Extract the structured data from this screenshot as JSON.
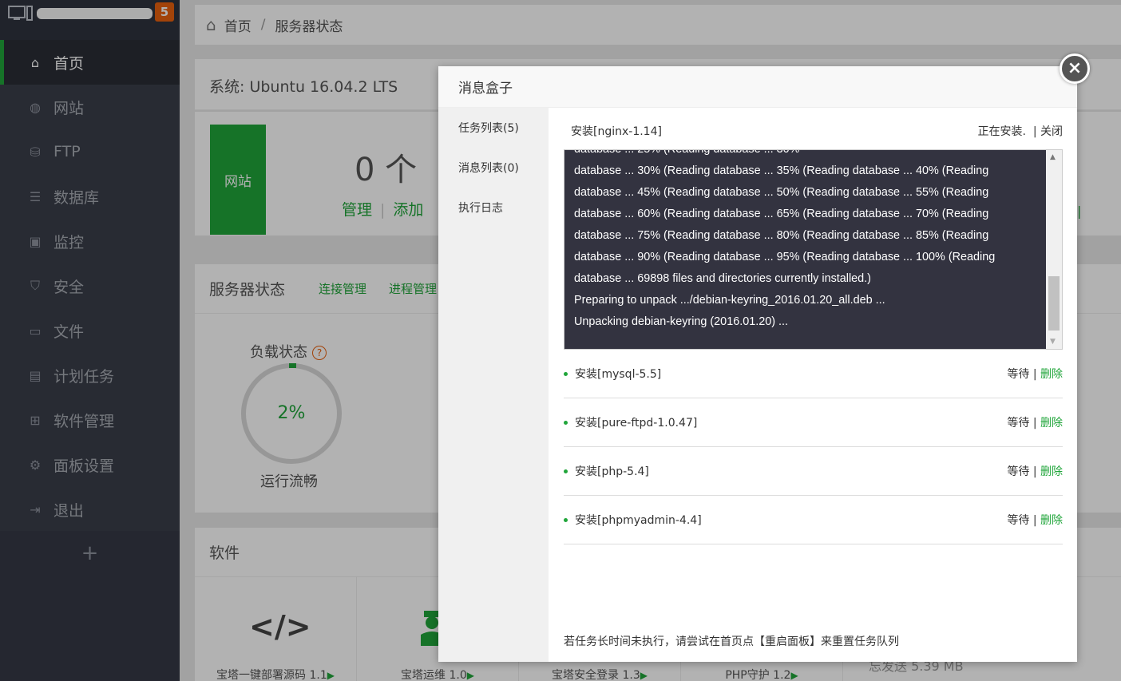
{
  "sidebar": {
    "badge": "5",
    "items": [
      {
        "label": "首页",
        "icon": "home-icon"
      },
      {
        "label": "网站",
        "icon": "globe-icon"
      },
      {
        "label": "FTP",
        "icon": "ftp-icon"
      },
      {
        "label": "数据库",
        "icon": "database-icon"
      },
      {
        "label": "监控",
        "icon": "monitor-icon"
      },
      {
        "label": "安全",
        "icon": "shield-icon"
      },
      {
        "label": "文件",
        "icon": "folder-icon"
      },
      {
        "label": "计划任务",
        "icon": "calendar-icon"
      },
      {
        "label": "软件管理",
        "icon": "grid-icon"
      },
      {
        "label": "面板设置",
        "icon": "gear-icon"
      },
      {
        "label": "退出",
        "icon": "logout-icon"
      }
    ],
    "add": "+"
  },
  "breadcrumb": {
    "home": "首页",
    "sep": "/",
    "current": "服务器状态"
  },
  "system": {
    "title": "系统: Ubuntu 16.04.2 LTS"
  },
  "site": {
    "label": "网站",
    "count": "0 个",
    "manage": "管理",
    "bar": "|",
    "add": "添加"
  },
  "status": {
    "title": "服务器状态",
    "link1": "连接管理",
    "link2": "进程管理",
    "load_title": "负载状态",
    "help": "?",
    "load_value": "2%",
    "load_percent": 2,
    "load_text": "运行流畅"
  },
  "software": {
    "title": "软件",
    "items": [
      {
        "name": "宝塔一键部署源码 1.1"
      },
      {
        "name": "宝塔运维 1.0"
      },
      {
        "name": "宝塔安全登录 1.3"
      },
      {
        "name": "PHP守护 1.2"
      }
    ],
    "right_fragment": "忘发送    5.39 MB"
  },
  "modal": {
    "title": "消息盒子",
    "close": "×",
    "tabs": [
      "任务列表(5)",
      "消息列表(0)",
      "执行日志"
    ],
    "current_task": {
      "name": "安装[nginx-1.14]",
      "status": "正在安装.",
      "close": "| 关闭"
    },
    "log_lines": [
      "database ... 30% (Reading database ... 35% (Reading database ... 40% (Reading",
      "database ... 45% (Reading database ... 50% (Reading database ... 55% (Reading",
      "database ... 60% (Reading database ... 65% (Reading database ... 70% (Reading",
      "database ... 75% (Reading database ... 80% (Reading database ... 85% (Reading",
      "database ... 90% (Reading database ... 95% (Reading database ... 100% (Reading",
      "database ... 69898 files and directories currently installed.)",
      "Preparing to unpack .../debian-keyring_2016.01.20_all.deb ...",
      "Unpacking debian-keyring (2016.01.20) ..."
    ],
    "tasks": [
      {
        "name": "安装[mysql-5.5]",
        "status": "等待",
        "sep": "|",
        "delete": "删除"
      },
      {
        "name": "安装[pure-ftpd-1.0.47]",
        "status": "等待",
        "sep": "|",
        "delete": "删除"
      },
      {
        "name": "安装[php-5.4]",
        "status": "等待",
        "sep": "|",
        "delete": "删除"
      },
      {
        "name": "安装[phpmyadmin-4.4]",
        "status": "等待",
        "sep": "|",
        "delete": "删除"
      }
    ],
    "footer": "若任务长时间未执行，请尝试在首页点【重启面板】来重置任务队列"
  },
  "colors": {
    "accent": "#20a53a",
    "badge": "#e8600e",
    "sidebar": "#3a3e4a"
  }
}
